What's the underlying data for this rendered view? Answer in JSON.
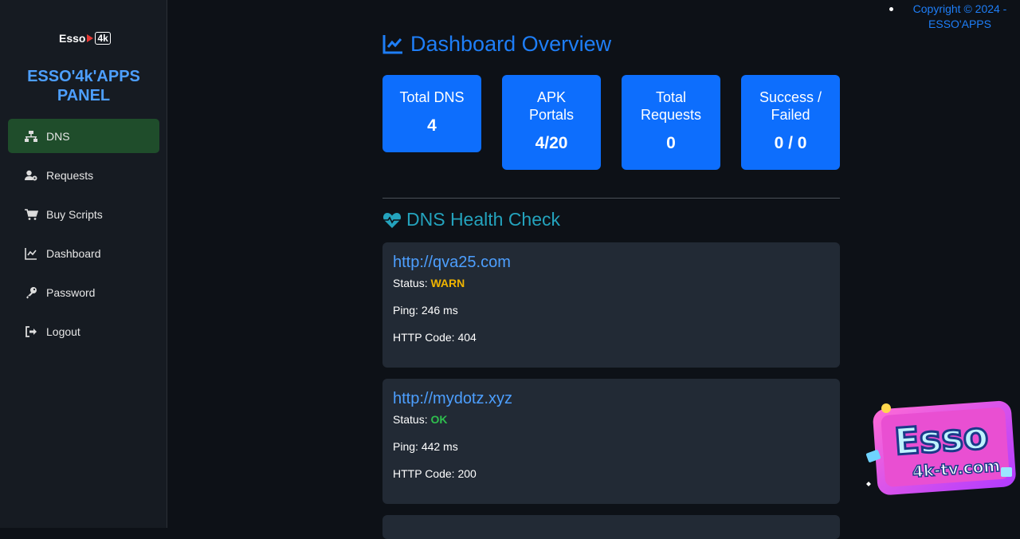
{
  "sidebar": {
    "logo_text": "Esso",
    "logo_badge": "4k",
    "brand_line1": "ESSO'4k'APPS",
    "brand_line2": "PANEL",
    "items": [
      {
        "label": "DNS",
        "icon": "network-icon",
        "active": true
      },
      {
        "label": "Requests",
        "icon": "user-gear-icon"
      },
      {
        "label": "Buy Scripts",
        "icon": "cart-icon"
      },
      {
        "label": "Dashboard",
        "icon": "chart-line-icon"
      },
      {
        "label": "Password",
        "icon": "key-icon"
      },
      {
        "label": "Logout",
        "icon": "logout-icon"
      }
    ]
  },
  "copyright": "Copyright © 2024 - ESSO'APPS",
  "main": {
    "title": "Dashboard Overview",
    "stats": [
      {
        "label": "Total DNS",
        "value": "4"
      },
      {
        "label": "APK Portals",
        "value": "4/20"
      },
      {
        "label": "Total Requests",
        "value": "0"
      },
      {
        "label": "Success / Failed",
        "value": "0 / 0"
      }
    ],
    "health_title": "DNS Health Check",
    "dns": [
      {
        "url": "http://qva25.com",
        "status_label": "Status:",
        "status": "WARN",
        "ping_label": "Ping:",
        "ping": "246 ms",
        "http_label": "HTTP Code:",
        "http": "404"
      },
      {
        "url": "http://mydotz.xyz",
        "status_label": "Status:",
        "status": "OK",
        "ping_label": "Ping:",
        "ping": "442 ms",
        "http_label": "HTTP Code:",
        "http": "200"
      }
    ]
  },
  "badge": {
    "title": "Esso",
    "subtitle": "4k-tv.com"
  },
  "colors": {
    "accent": "#1e7ef7",
    "active_nav": "#1f4d2b",
    "stat_card": "#0d6efd",
    "warn": "#f0b400",
    "ok": "#2fbf4e"
  }
}
